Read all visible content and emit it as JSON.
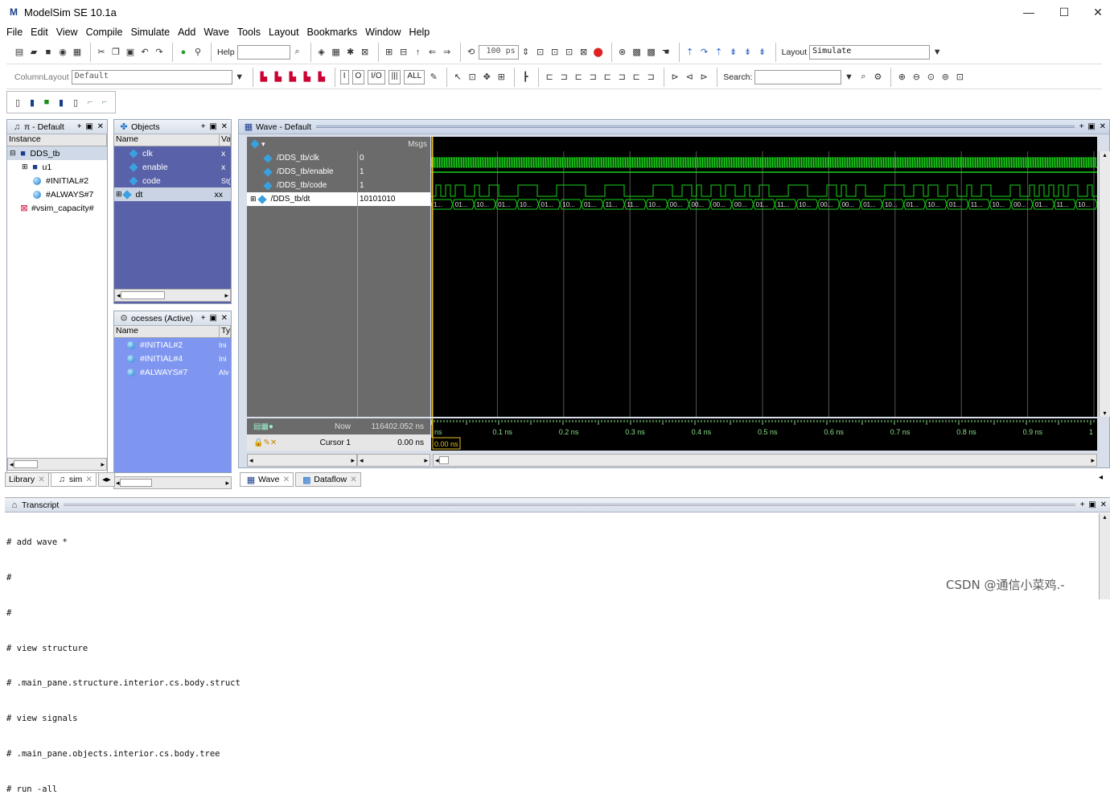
{
  "window": {
    "title": "ModelSim SE 10.1a",
    "logo": "M",
    "minimize": "—",
    "maximize": "☐",
    "close": "✕"
  },
  "menu": [
    "File",
    "Edit",
    "View",
    "Compile",
    "Simulate",
    "Add",
    "Wave",
    "Tools",
    "Layout",
    "Bookmarks",
    "Window",
    "Help"
  ],
  "toolbar": {
    "help_label": "Help",
    "run_length": "100 ps",
    "layout_label": "Layout",
    "layout_value": "Simulate",
    "column_layout_label": "ColumnLayout",
    "column_layout_value": "Default",
    "search_label": "Search:",
    "signal_buttons": [
      "I",
      "O",
      "I/O",
      "|||",
      "ALL"
    ]
  },
  "structure_pane": {
    "title": "π - Default",
    "col_instance": "Instance",
    "items": [
      "DDS_tb",
      "u1",
      "#INITIAL#2",
      "#ALWAYS#7",
      "#vsim_capacity#"
    ]
  },
  "objects_pane": {
    "title": "Objects",
    "col_name": "Name",
    "col_value": "Va",
    "items": [
      {
        "name": "clk",
        "value": "x"
      },
      {
        "name": "enable",
        "value": "x"
      },
      {
        "name": "code",
        "value": "St("
      },
      {
        "name": "dt",
        "value": "xx"
      }
    ]
  },
  "processes_pane": {
    "title": "ocesses (Active)",
    "col_name": "Name",
    "col_type": "Ty",
    "items": [
      {
        "name": "#INITIAL#2",
        "type": "Ini"
      },
      {
        "name": "#INITIAL#4",
        "type": "Ini"
      },
      {
        "name": "#ALWAYS#7",
        "type": "Alv"
      }
    ]
  },
  "wave_pane": {
    "title": "Wave - Default",
    "msgs_label": "Msgs",
    "signals": [
      {
        "name": "/DDS_tb/clk",
        "value": "0"
      },
      {
        "name": "/DDS_tb/enable",
        "value": "1"
      },
      {
        "name": "/DDS_tb/code",
        "value": "1"
      },
      {
        "name": "/DDS_tb/dt",
        "value": "10101010"
      }
    ],
    "now_label": "Now",
    "now_value": "116402.052 ns",
    "cursor_label": "Cursor 1",
    "cursor_value": "0.00 ns",
    "cursor_tag": "0.00 ns",
    "time_ticks": [
      "ns",
      "0.1 ns",
      "0.2 ns",
      "0.3 ns",
      "0.4 ns",
      "0.5 ns",
      "0.6 ns",
      "0.7 ns",
      "0.8 ns",
      "0.9 ns",
      "1"
    ],
    "bus_values": [
      "1...",
      "01...",
      "10...",
      "01...",
      "10...",
      "01...",
      "10...",
      "01...",
      "11...",
      "11...",
      "10...",
      "00...",
      "00...",
      "00...",
      "00...",
      "01...",
      "11...",
      "10...",
      "00...",
      "00...",
      "01...",
      "10...",
      "01...",
      "10...",
      "01...",
      "11...",
      "10...",
      "00...",
      "01...",
      "11...",
      "10..."
    ]
  },
  "bottom_tabs_left": [
    "Library",
    "sim"
  ],
  "bottom_tabs_wave": [
    "Wave",
    "Dataflow"
  ],
  "transcript": {
    "title": "Transcript",
    "lines": [
      "# add wave *",
      "#",
      "#",
      "# view structure",
      "# .main_pane.structure.interior.cs.body.struct",
      "# view signals",
      "# .main_pane.objects.interior.cs.body.tree",
      "# run -all"
    ]
  },
  "watermark": "CSDN @通信小菜鸡.-",
  "colors": {
    "wave_green": "#19d219",
    "cursor_yellow": "#e8c020",
    "objects_bg": "#5962a8",
    "processes_bg": "#7f96f0",
    "name_bg": "#6b6b6b"
  }
}
